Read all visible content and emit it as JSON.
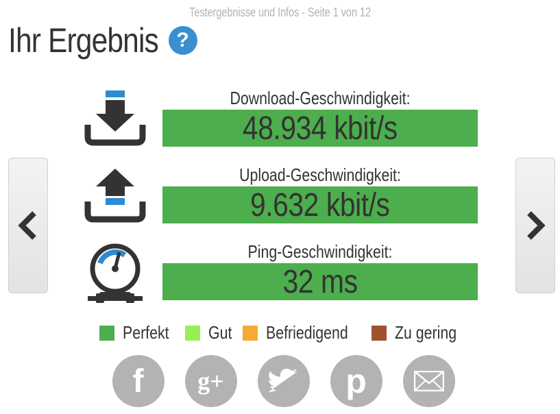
{
  "pager": "Testergebnisse und Infos - Seite 1 von 12",
  "title": "Ihr Ergebnis",
  "help_glyph": "?",
  "results": [
    {
      "label": "Download-Geschwindigkeit:",
      "value": "48.934 kbit/s",
      "icon": "download-icon"
    },
    {
      "label": "Upload-Geschwindigkeit:",
      "value": "9.632 kbit/s",
      "icon": "upload-icon"
    },
    {
      "label": "Ping-Geschwindigkeit:",
      "value": "32 ms",
      "icon": "gauge-icon"
    }
  ],
  "legend": [
    {
      "label": "Perfekt",
      "color": "#4cae4c"
    },
    {
      "label": "Gut",
      "color": "#99ee55"
    },
    {
      "label": "Befriedigend",
      "color": "#f7a935"
    },
    {
      "label": "Zu gering",
      "color": "#a0522d"
    }
  ],
  "colors": {
    "bar": "#4cae4c",
    "icon_accent": "#2e8bd1",
    "social": "#b3b3b3"
  },
  "social": [
    {
      "name": "facebook",
      "glyph": "f"
    },
    {
      "name": "google-plus",
      "glyph": "g+"
    },
    {
      "name": "twitter",
      "glyph": ""
    },
    {
      "name": "pinterest",
      "glyph": "p"
    },
    {
      "name": "email",
      "glyph": ""
    }
  ]
}
